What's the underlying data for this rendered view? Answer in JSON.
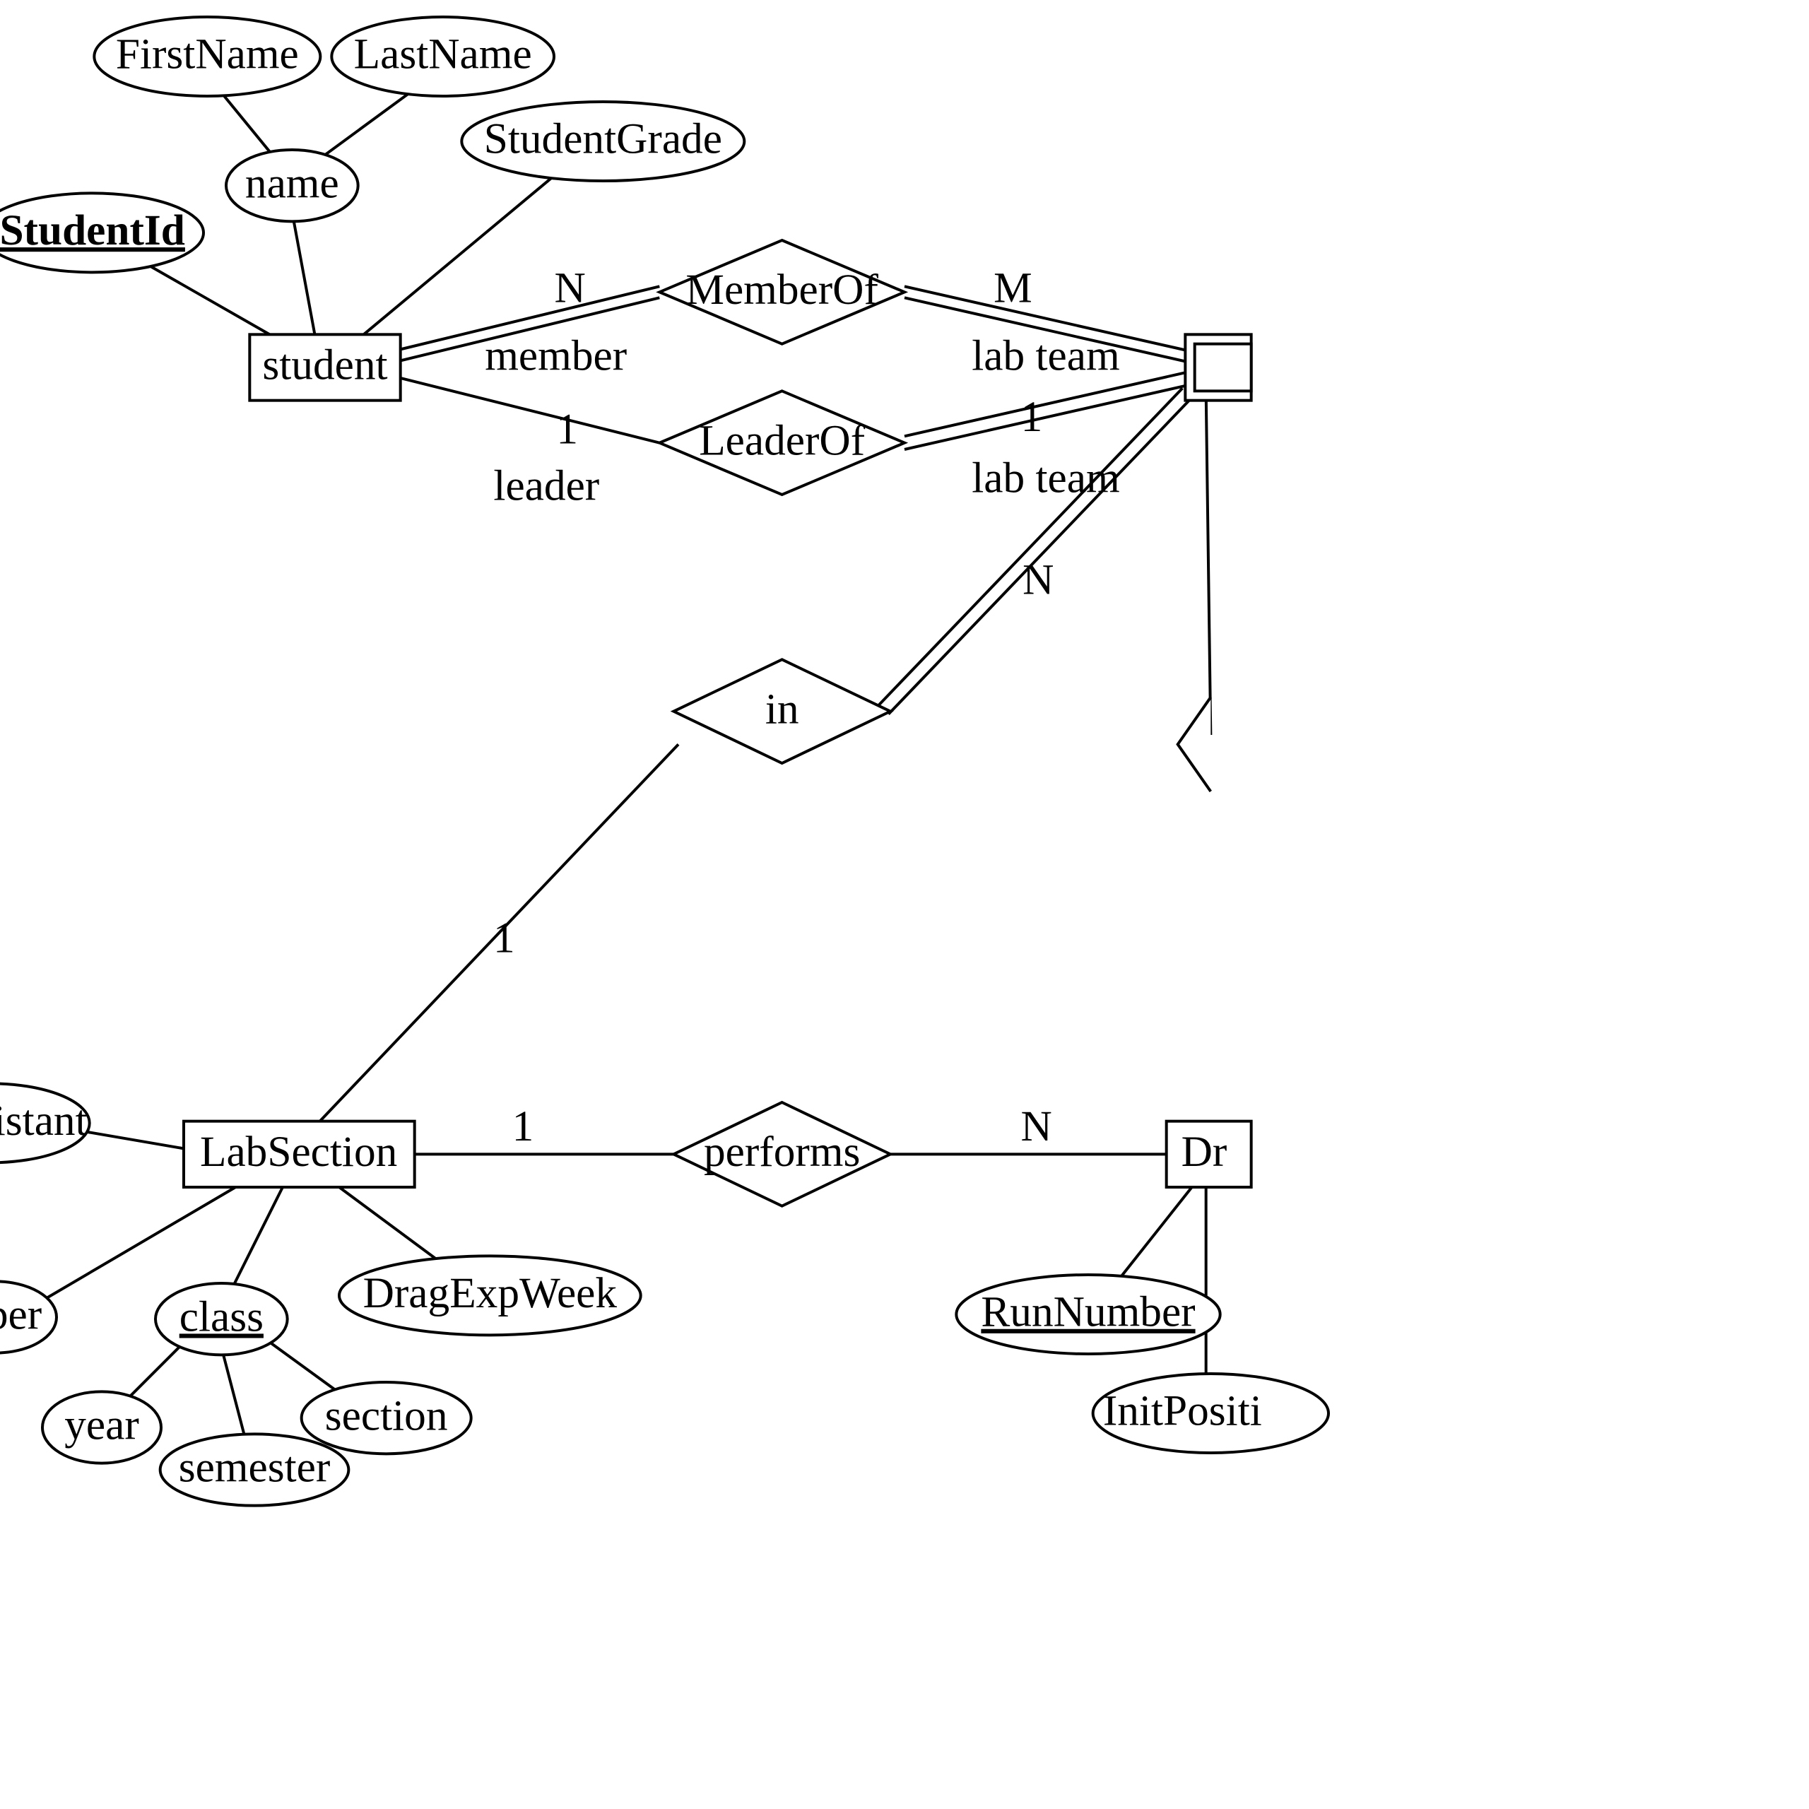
{
  "entities": {
    "student": "student",
    "labSection": "LabSection",
    "labTeam": "",
    "drag": "Dr"
  },
  "attributes": {
    "firstName": "FirstName",
    "lastName": "LastName",
    "name": "name",
    "studentId": "StudentId",
    "studentGrade": "StudentGrade",
    "assistant": "ssistant",
    "ber": "ber",
    "year": "year",
    "semester": "semester",
    "section": "section",
    "class": "class",
    "dragExpWeek": "DragExpWeek",
    "runNumber": "RunNumber",
    "initPositi": "InitPositi"
  },
  "relationships": {
    "memberOf": "MemberOf",
    "leaderOf": "LeaderOf",
    "in": "in",
    "performs": "performs"
  },
  "labels": {
    "N1": "N",
    "M1": "M",
    "member": "member",
    "labteam1": "lab team",
    "one1": "1",
    "one2": "1",
    "leader": "leader",
    "labteam2": "lab team",
    "Nin": "N",
    "oneIn": "1",
    "onePerforms": "1",
    "NPerforms": "N"
  }
}
